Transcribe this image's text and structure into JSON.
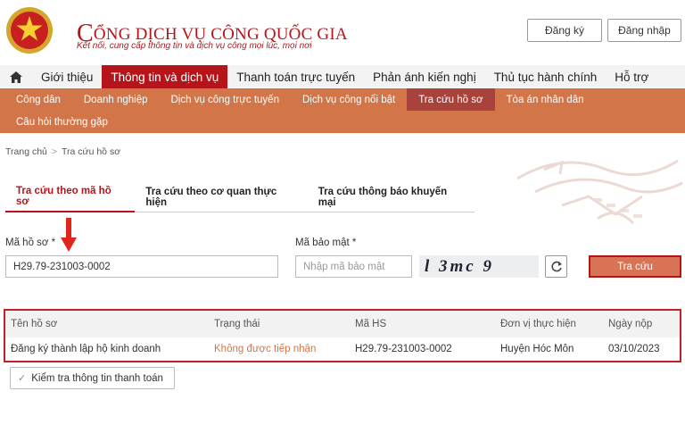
{
  "header": {
    "title_initial": "C",
    "title_rest": "ỔNG DỊCH VỤ CÔNG QUỐC GIA",
    "subtitle": "Kết nối, cung cấp thông tin và dịch vụ công mọi lúc, mọi nơi",
    "register_label": "Đăng ký",
    "login_label": "Đăng nhập"
  },
  "nav": {
    "items": [
      "Giới thiệu",
      "Thông tin và dịch vụ",
      "Thanh toán trực tuyến",
      "Phản ánh kiến nghị",
      "Thủ tục hành chính",
      "Hỗ trợ"
    ],
    "active": "Thông tin và dịch vụ"
  },
  "subnav": {
    "items": [
      "Công dân",
      "Doanh nghiệp",
      "Dịch vụ công trực tuyến",
      "Dịch vụ công nổi bật",
      "Tra cứu hồ sơ",
      "Tòa án nhân dân"
    ],
    "items_row2": [
      "Câu hỏi thường gặp"
    ],
    "active": "Tra cứu hồ sơ"
  },
  "breadcrumb": {
    "home": "Trang chủ",
    "sep": ">",
    "current": "Tra cứu hồ sơ"
  },
  "tabs": [
    "Tra cứu theo mã hồ sơ",
    "Tra cứu theo cơ quan thực hiện",
    "Tra cứu thông báo khuyến mại"
  ],
  "form": {
    "code_label": "Mã hồ sơ *",
    "code_value": "H29.79-231003-0002",
    "security_label": "Mã bảo mật *",
    "security_placeholder": "Nhập mã bảo mật",
    "captcha_text": "l3mc9",
    "submit_label": "Tra cứu"
  },
  "results": {
    "columns": [
      "Tên hồ sơ",
      "Trạng thái",
      "Mã HS",
      "Đơn vị thực hiện",
      "Ngày nộp"
    ],
    "rows": [
      [
        "Đăng ký thành lập hộ kinh doanh",
        "Không được tiếp nhận",
        "H29.79-231003-0002",
        "Huyện Hóc Môn",
        "03/10/2023"
      ]
    ]
  },
  "check_payment_label": "Kiểm tra thông tin thanh toán",
  "colors": {
    "brand_red": "#b5151a",
    "subnav_orange": "#d2764a",
    "subnav_active": "#a9423b",
    "button_orange": "#d97356"
  }
}
